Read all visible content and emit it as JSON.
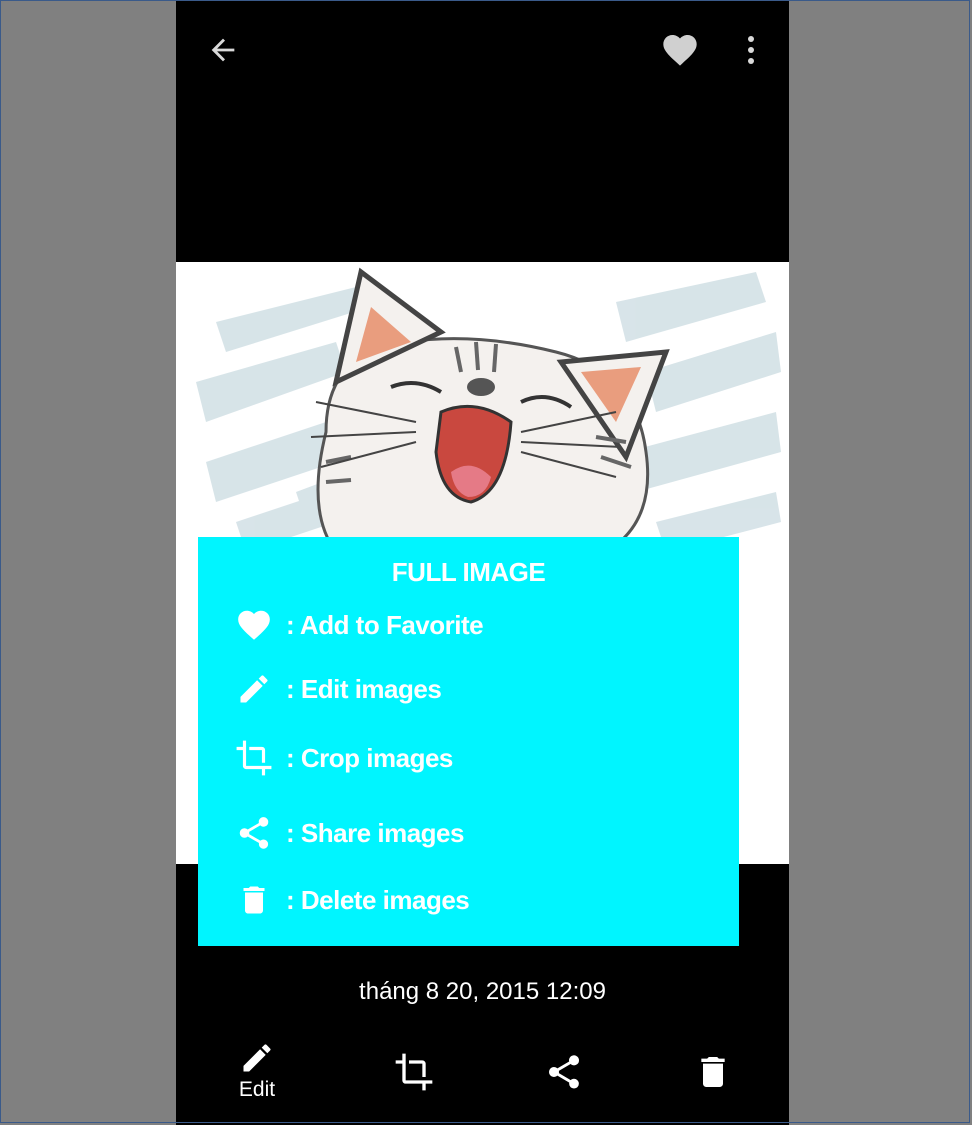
{
  "topbar": {
    "back_icon": "arrow-left-icon",
    "favorite_icon": "heart-icon",
    "more_icon": "more-vert-icon"
  },
  "overlay": {
    "title": "FULL IMAGE",
    "background": "#00f5ff",
    "items": [
      {
        "icon": "heart-icon",
        "label": ": Add to Favorite"
      },
      {
        "icon": "pencil-icon",
        "label": ": Edit images"
      },
      {
        "icon": "crop-icon",
        "label": ": Crop images"
      },
      {
        "icon": "share-icon",
        "label": ": Share images"
      },
      {
        "icon": "trash-icon",
        "label": ": Delete images"
      }
    ]
  },
  "photo": {
    "subject": "cartoon-laughing-cat"
  },
  "timestamp": "tháng 8 20, 2015 12:09",
  "bottombar": {
    "edit_label": "Edit",
    "edit_icon": "pencil-icon",
    "crop_icon": "crop-icon",
    "share_icon": "share-icon",
    "delete_icon": "trash-icon"
  }
}
